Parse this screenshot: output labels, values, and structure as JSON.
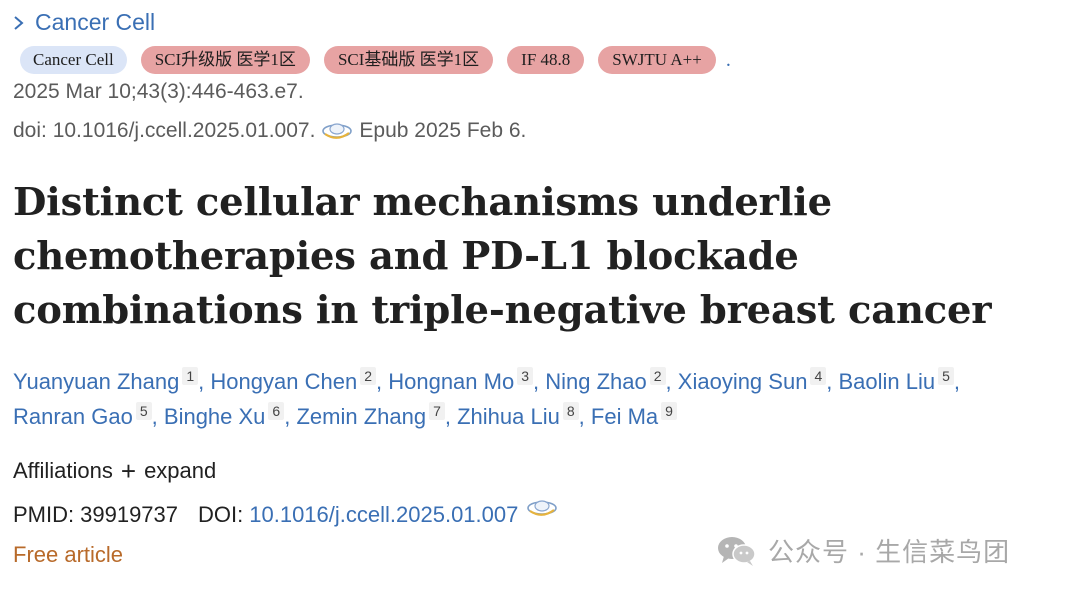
{
  "journal": {
    "link_text": "Cancer Cell",
    "badges": [
      {
        "text": "Cancer Cell",
        "kind": "journal"
      },
      {
        "text": "SCI升级版 医学1区",
        "kind": "rank"
      },
      {
        "text": "SCI基础版 医学1区",
        "kind": "rank"
      },
      {
        "text": "IF 48.8",
        "kind": "rank"
      },
      {
        "text": "SWJTU A++",
        "kind": "rank"
      }
    ],
    "badge_trailing": ".",
    "citation": "2025 Mar 10;43(3):446-463.e7.",
    "doi_text": "doi: 10.1016/j.ccell.2025.01.007.",
    "epub": "Epub 2025 Feb 6."
  },
  "article": {
    "title": "Distinct cellular mechanisms underlie chemotherapies and PD-L1 blockade combinations in triple-negative breast cancer"
  },
  "authors": [
    {
      "name": "Yuanyuan Zhang",
      "aff": "1"
    },
    {
      "name": "Hongyan Chen",
      "aff": "2"
    },
    {
      "name": "Hongnan Mo",
      "aff": "3"
    },
    {
      "name": "Ning Zhao",
      "aff": "2"
    },
    {
      "name": "Xiaoying Sun",
      "aff": "4"
    },
    {
      "name": "Baolin Liu",
      "aff": "5"
    },
    {
      "name": "Ranran Gao",
      "aff": "5"
    },
    {
      "name": "Binghe Xu",
      "aff": "6"
    },
    {
      "name": "Zemin Zhang",
      "aff": "7"
    },
    {
      "name": "Zhihua Liu",
      "aff": "8"
    },
    {
      "name": "Fei Ma",
      "aff": "9"
    }
  ],
  "affiliations": {
    "label": "Affiliations",
    "toggle": "expand"
  },
  "identifiers": {
    "pmid_label": "PMID:",
    "pmid": "39919737",
    "doi_label": "DOI:",
    "doi": "10.1016/j.ccell.2025.01.007"
  },
  "free_article": "Free article",
  "watermark": "公众号 · 生信菜鸟团",
  "colors": {
    "link": "#3a6fb4",
    "badge_rank": "#e7a3a3",
    "badge_journal": "#dbe5f7",
    "free": "#b86a2a"
  }
}
